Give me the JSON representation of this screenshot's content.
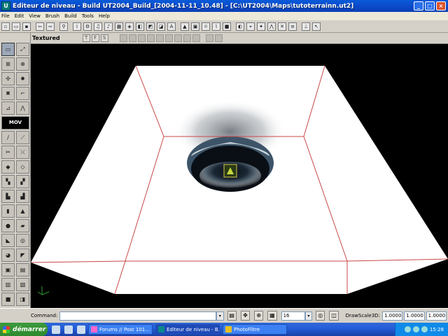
{
  "window": {
    "title": "Editeur de niveau - Build UT2004_Build_[2004-11-11_10.48] - [C:\\UT2004\\Maps\\tutoterrainn.ut2]",
    "app_icon": "unreal-u-icon",
    "buttons": [
      "minimize",
      "maximize",
      "close"
    ]
  },
  "menu": {
    "items": [
      "File",
      "Edit",
      "View",
      "Brush",
      "Build",
      "Tools",
      "Help"
    ]
  },
  "toolbar": {
    "items": [
      "new",
      "open",
      "save",
      "undo-arrow",
      "redo-arrow",
      "find",
      "info",
      "actor",
      "music",
      "sound",
      "texture",
      "mesh",
      "static-mesh",
      "animation",
      "prefab",
      "font",
      "group",
      "build-geometry",
      "build-lighting",
      "build-paths",
      "build-all",
      "play",
      "camera",
      "light",
      "terrain",
      "matinee",
      "kismet",
      "hammer",
      "cursor"
    ],
    "font_label": "A"
  },
  "toolbox": {
    "mov_label": "MOV"
  },
  "viewport": {
    "mode_label": "Textured",
    "lock_buttons": [
      "T",
      "F",
      "S"
    ],
    "background": "#000000",
    "grid_color": "#c84848",
    "floor_color": "#ffffff",
    "hole_color": "#1b2430"
  },
  "command_bar": {
    "label": "Command:",
    "value": "",
    "grid_size": "16",
    "drawscale_label": "DrawScale3D:",
    "drawscale": [
      "1.0000",
      "1.0000",
      "1.0000"
    ]
  },
  "taskbar": {
    "start_label": "démarrer",
    "tasks": [
      {
        "label": "Forums // Post 101...",
        "active": false
      },
      {
        "label": "Editeur de niveau - B...",
        "active": true
      },
      {
        "label": "PhotoFiltre",
        "active": false
      }
    ],
    "clock": "15:28"
  }
}
